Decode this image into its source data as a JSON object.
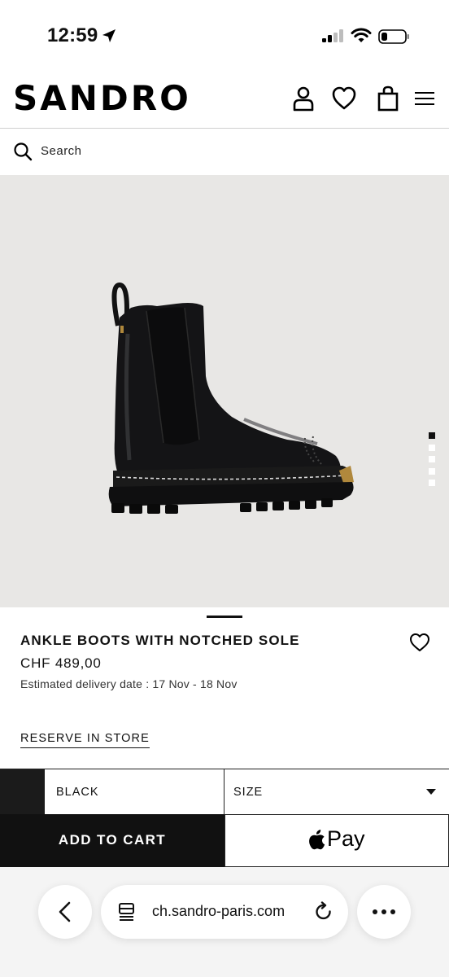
{
  "status_bar": {
    "time": "12:59"
  },
  "header": {
    "brand": "SANDRO",
    "icons": [
      "account-icon",
      "heart-icon",
      "shopping-bag-icon",
      "hamburger-menu-icon"
    ]
  },
  "search": {
    "placeholder": "Search"
  },
  "product": {
    "image_subject": "black leather chelsea ankle boot",
    "gallery_total": 5,
    "gallery_active": 1,
    "title": "ANKLE BOOTS WITH NOTCHED SOLE",
    "price": "CHF 489,00",
    "delivery": "Estimated delivery date : 17 Nov - 18 Nov",
    "reserve_label": "RESERVE IN STORE"
  },
  "selectors": {
    "color_label": "BLACK",
    "swatch_color": "#1b1b1b",
    "size_label": "SIZE"
  },
  "actions": {
    "add_to_cart": "ADD TO CART",
    "apple_pay": "Pay"
  },
  "browser": {
    "url": "ch.sandro-paris.com"
  },
  "colors": {
    "accent": "#111111",
    "image_background": "#e8e7e5"
  }
}
